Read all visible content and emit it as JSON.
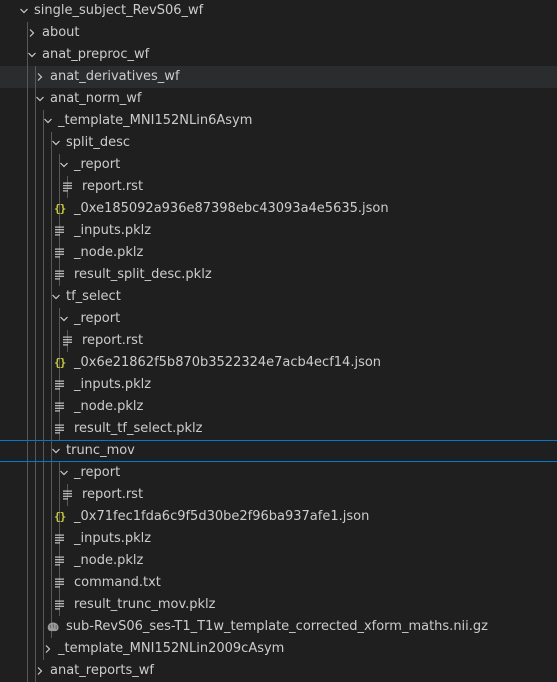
{
  "explorer": {
    "rows": [
      {
        "label": "single_subject_RevS06_wf",
        "depth": 0,
        "kind": "folder",
        "expanded": true
      },
      {
        "label": "about",
        "depth": 1,
        "kind": "folder",
        "expanded": false
      },
      {
        "label": "anat_preproc_wf",
        "depth": 1,
        "kind": "folder",
        "expanded": true
      },
      {
        "label": "anat_derivatives_wf",
        "depth": 2,
        "kind": "folder",
        "expanded": false,
        "state": "hover"
      },
      {
        "label": "anat_norm_wf",
        "depth": 2,
        "kind": "folder",
        "expanded": true
      },
      {
        "label": "_template_MNI152NLin6Asym",
        "depth": 3,
        "kind": "folder",
        "expanded": true
      },
      {
        "label": "split_desc",
        "depth": 4,
        "kind": "folder",
        "expanded": true
      },
      {
        "label": "_report",
        "depth": 5,
        "kind": "folder",
        "expanded": true
      },
      {
        "label": "report.rst",
        "depth": 6,
        "kind": "file",
        "icon": "text-file-icon"
      },
      {
        "label": "_0xe185092a936e87398ebc43093a4e5635.json",
        "depth": 5,
        "kind": "file",
        "icon": "json-icon"
      },
      {
        "label": "_inputs.pklz",
        "depth": 5,
        "kind": "file",
        "icon": "text-file-icon"
      },
      {
        "label": "_node.pklz",
        "depth": 5,
        "kind": "file",
        "icon": "text-file-icon"
      },
      {
        "label": "result_split_desc.pklz",
        "depth": 5,
        "kind": "file",
        "icon": "text-file-icon"
      },
      {
        "label": "tf_select",
        "depth": 4,
        "kind": "folder",
        "expanded": true
      },
      {
        "label": "_report",
        "depth": 5,
        "kind": "folder",
        "expanded": true
      },
      {
        "label": "report.rst",
        "depth": 6,
        "kind": "file",
        "icon": "text-file-icon"
      },
      {
        "label": "_0x6e21862f5b870b3522324e7acb4ecf14.json",
        "depth": 5,
        "kind": "file",
        "icon": "json-icon"
      },
      {
        "label": "_inputs.pklz",
        "depth": 5,
        "kind": "file",
        "icon": "text-file-icon"
      },
      {
        "label": "_node.pklz",
        "depth": 5,
        "kind": "file",
        "icon": "text-file-icon"
      },
      {
        "label": "result_tf_select.pklz",
        "depth": 5,
        "kind": "file",
        "icon": "text-file-icon"
      },
      {
        "label": "trunc_mov",
        "depth": 4,
        "kind": "folder",
        "expanded": true,
        "state": "focused"
      },
      {
        "label": "_report",
        "depth": 5,
        "kind": "folder",
        "expanded": true
      },
      {
        "label": "report.rst",
        "depth": 6,
        "kind": "file",
        "icon": "text-file-icon"
      },
      {
        "label": "_0x71fec1fda6c9f5d30be2f96ba937afe1.json",
        "depth": 5,
        "kind": "file",
        "icon": "json-icon"
      },
      {
        "label": "_inputs.pklz",
        "depth": 5,
        "kind": "file",
        "icon": "text-file-icon"
      },
      {
        "label": "_node.pklz",
        "depth": 5,
        "kind": "file",
        "icon": "text-file-icon"
      },
      {
        "label": "command.txt",
        "depth": 5,
        "kind": "file",
        "icon": "text-file-icon"
      },
      {
        "label": "result_trunc_mov.pklz",
        "depth": 5,
        "kind": "file",
        "icon": "text-file-icon"
      },
      {
        "label": "sub-RevS06_ses-T1_T1w_template_corrected_xform_maths.nii.gz",
        "depth": 4,
        "kind": "file",
        "icon": "brain-image-icon"
      },
      {
        "label": "_template_MNI152NLin2009cAsym",
        "depth": 3,
        "kind": "folder",
        "expanded": false
      },
      {
        "label": "anat_reports_wf",
        "depth": 2,
        "kind": "folder",
        "expanded": false
      }
    ]
  },
  "colors": {
    "background": "#1f1f1f",
    "text": "#cccccc",
    "hover_background": "#2a2d2e",
    "focus_border": "#0078d4",
    "indent_guide": "#585858",
    "json_icon": "#cbcb41",
    "file_icon": "#c5c5c5"
  }
}
